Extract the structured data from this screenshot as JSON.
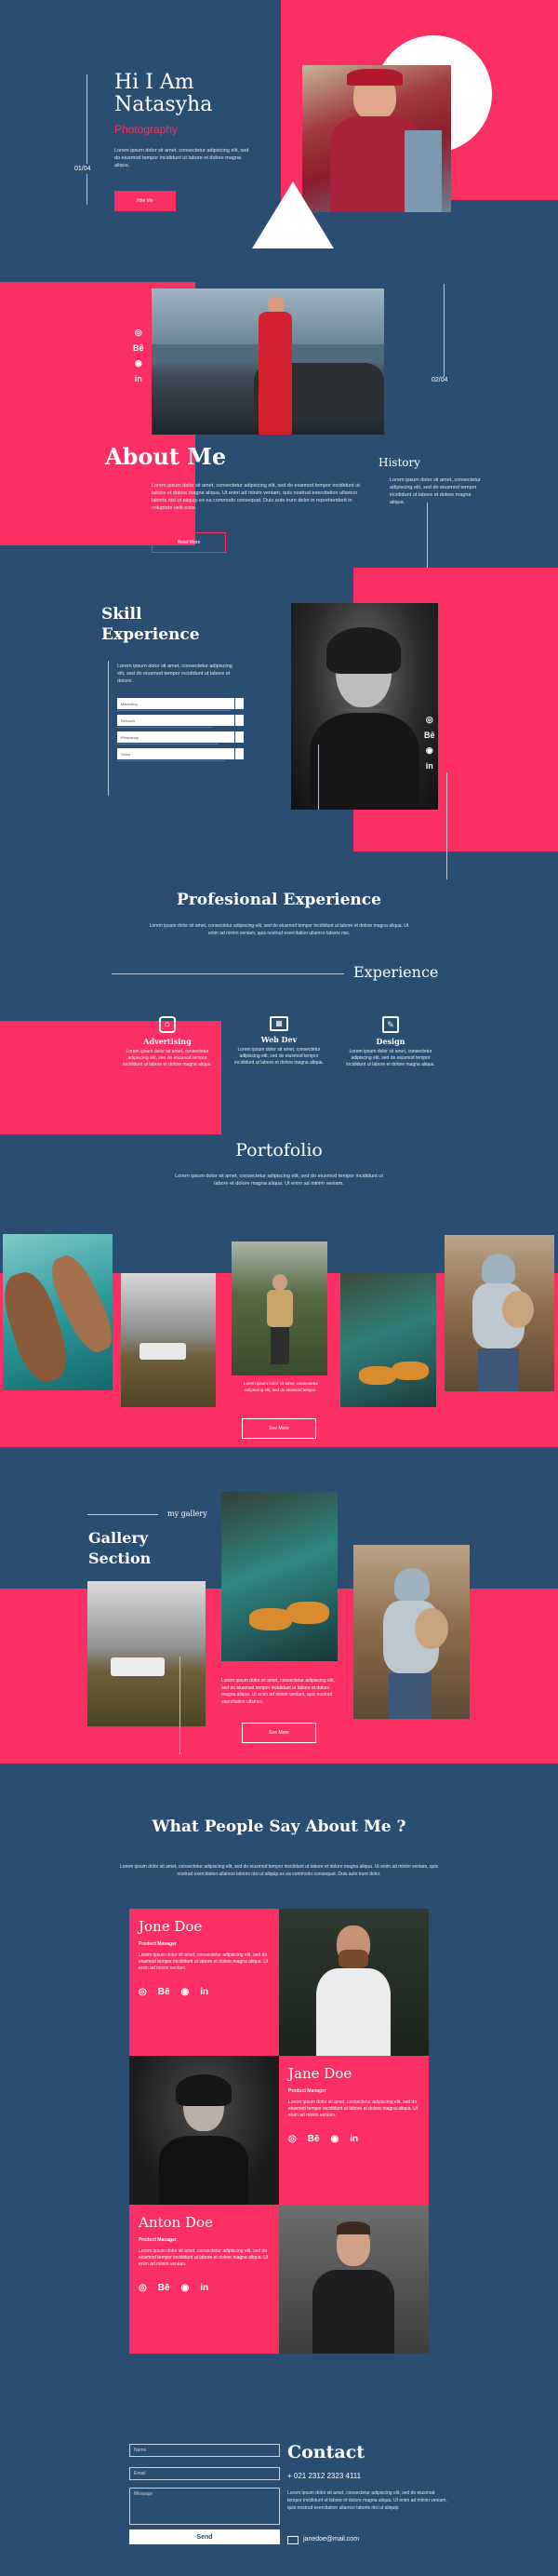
{
  "hero": {
    "greeting": "Hi I Am",
    "name": "Natasyha",
    "role": "Photography",
    "counter": "01/04",
    "text": "Lorem ipsum dolor sit amet, consectetur adipiscing elit, sed do eiusmod tempor incididunt ut labore et dolore magna aliqua.",
    "button": "Hire Me"
  },
  "about": {
    "title": "About Me",
    "counter": "02/04",
    "text": "Lorem ipsum dolor sit amet, consectetur adipiscing elit, sed do eiusmod tempor incididunt ut labore et dolore magna aliqua. Ut enim ad minim veniam, quis nostrud exercitation ullamco laboris nisi ut aliquip ex ea commodo consequat. Duis aute irure dolor in reprehenderit in voluptate velit esse.",
    "button": "Read More",
    "history_title": "History",
    "history_text": "Lorem ipsum dolor sit amet, consectetur adipiscing elit, sed do eiusmod tempor incididunt ut labore et dolore magna aliqua.",
    "social": [
      "◎",
      "Bē",
      "◉",
      "in"
    ]
  },
  "skill": {
    "title_line1": "Skill",
    "title_line2": "Experience",
    "text": "Lorem ipsum dolor sit amet, consectetur adipiscing elit, sed do eiusmod tempor incididunt ut labore et dolore.",
    "skills": [
      {
        "label": "Marketing",
        "level": 0.9
      },
      {
        "label": "Retouch",
        "level": 0.75
      },
      {
        "label": "Photoshop",
        "level": 0.8
      },
      {
        "label": "Video",
        "level": 0.85
      }
    ],
    "social": [
      "◎",
      "Bē",
      "◉",
      "in"
    ]
  },
  "professional": {
    "title": "Profesional Experience",
    "text": "Lorem ipsum dolor sit amet, consectetur adipiscing elit, sed do eiusmod tempor incididunt ut labore et dolore magna aliqua. Ut enim ad minim veniam, quis nostrud exercitation ullamco laboris nisi.",
    "experience_label": "Experience",
    "services": [
      {
        "title": "Advertising",
        "text": "Lorem ipsum dolor sit amet, consectetur adipiscing elit, sed do eiusmod tempor incididunt ut labore et dolore magna aliqua."
      },
      {
        "title": "Web Dev",
        "text": "Lorem ipsum dolor sit amet, consectetur adipiscing elit, sed do eiusmod tempor incididunt ut labore et dolore magna aliqua."
      },
      {
        "title": "Design",
        "text": "Lorem ipsum dolor sit amet, consectetur adipiscing elit, sed do eiusmod tempor incididunt ut labore et dolore magna aliqua."
      }
    ]
  },
  "portfolio": {
    "title": "Portofolio",
    "text": "Lorem ipsum dolor sit amet, consectetur adipiscing elit, sed do eiusmod tempor incididunt ut labore et dolore magna aliqua. Ut enim ad minim veniam.",
    "caption": "Lorem ipsum dolor sit amet, consectetur adipiscing elit, sed do eiusmod tempor.",
    "button": "See More"
  },
  "gallery": {
    "label": "my gallery",
    "title_line1": "Gallery",
    "title_line2": "Section",
    "text": "Lorem ipsum dolor sit amet, consectetur adipiscing elit, sed do eiusmod tempor incididunt ut labore et dolore magna aliqua. Ut enim ad minim veniam, quis nostrud exercitation ullamco.",
    "button": "See More"
  },
  "testimonials": {
    "title": "What People Say About Me ?",
    "text": "Lorem ipsum dolor sit amet, consectetur adipiscing elit, sed do eiusmod tempor incididunt ut labore et dolore magna aliqua. Ut enim ad minim veniam, quis nostrud exercitation ullamco laboris nisi ut aliquip ex ea commodo consequat. Duis aute irure dolor.",
    "people": [
      {
        "name": "Jone Doe",
        "role": "Product Manager",
        "text": "Lorem ipsum dolor sit amet, consectetur adipiscing elit, sed do eiusmod tempor incididunt ut labore et dolore magna aliqua. Ut enim ad minim veniam."
      },
      {
        "name": "Jane Doe",
        "role": "Product Manager",
        "text": "Lorem ipsum dolor sit amet, consectetur adipiscing elit, sed do eiusmod tempor incididunt ut labore et dolore magna aliqua. Ut enim ad minim veniam."
      },
      {
        "name": "Anton Doe",
        "role": "Product Manager",
        "text": "Lorem ipsum dolor sit amet, consectetur adipiscing elit, sed do eiusmod tempor incididunt ut labore et dolore magna aliqua. Ut enim ad minim veniam."
      }
    ],
    "social": [
      "◎",
      "Bē",
      "◉",
      "in"
    ]
  },
  "contact": {
    "title": "Contact",
    "name_placeholder": "Name",
    "email_placeholder": "Email",
    "message_placeholder": "Message",
    "send": "Send",
    "phone": "+ 021 2312 2323 4111",
    "text": "Lorem ipsum dolor sit amet, consectetur adipiscing elit, sed do eiusmod tempor incididunt ut labore et dolore magna aliqua. Ut enim ad minim veniam, quis nostrud exercitation ullamco laboris nisi ut aliquip.",
    "email": "janedoe@mail.com"
  },
  "colors": {
    "navy": "#2b4d72",
    "pink": "#fb2f62",
    "white": "#ffffff"
  }
}
